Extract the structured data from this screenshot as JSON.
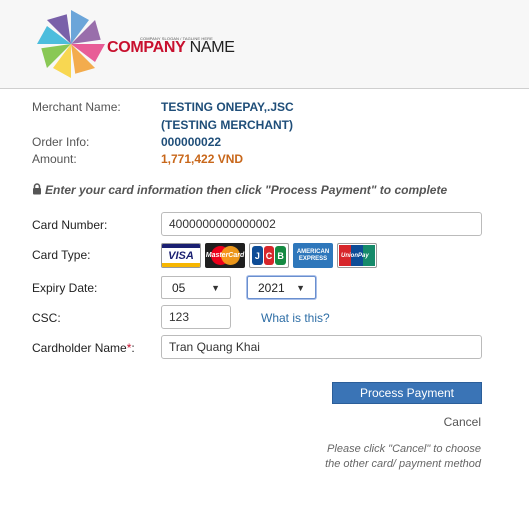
{
  "header": {
    "slogan": "COMPANY SLOGAN / TAGLINE HERE",
    "company_part1": "COMPANY",
    "company_part2": " NAME",
    "logo_colors": [
      "#5b9bd5",
      "#8e5ea2",
      "#e64b8c",
      "#f2a33a",
      "#f7d33e",
      "#7cc243",
      "#38b6d9",
      "#6a4fa0"
    ]
  },
  "order": {
    "merchant_label": "Merchant Name:",
    "merchant_line1": "TESTING ONEPAY,.JSC",
    "merchant_line2": "(TESTING MERCHANT)",
    "order_label": "Order Info:",
    "order_value": "000000022",
    "amount_label": "Amount:",
    "amount_value": "1,771,422 VND"
  },
  "notice": "Enter your card information then click \"Process Payment\" to complete",
  "form": {
    "card_number_label": "Card Number:",
    "card_number_value": "4000000000000002",
    "card_type_label": "Card Type:",
    "card_types": [
      "VISA",
      "MasterCard",
      "JCB",
      "AMERICAN EXPRESS",
      "UnionPay"
    ],
    "expiry_label": "Expiry Date:",
    "expiry_month": "05",
    "expiry_year": "2021",
    "csc_label": "CSC:",
    "csc_value": "123",
    "csc_help": "What is this?",
    "holder_label": "Cardholder Name",
    "holder_required": "*",
    "holder_colon": ":",
    "holder_value": "Tran Quang Khai"
  },
  "actions": {
    "process_button": "Process Payment",
    "cancel_link": "Cancel",
    "hint_line1": "Please click \"Cancel\" to choose",
    "hint_line2": "the other card/ payment method"
  }
}
